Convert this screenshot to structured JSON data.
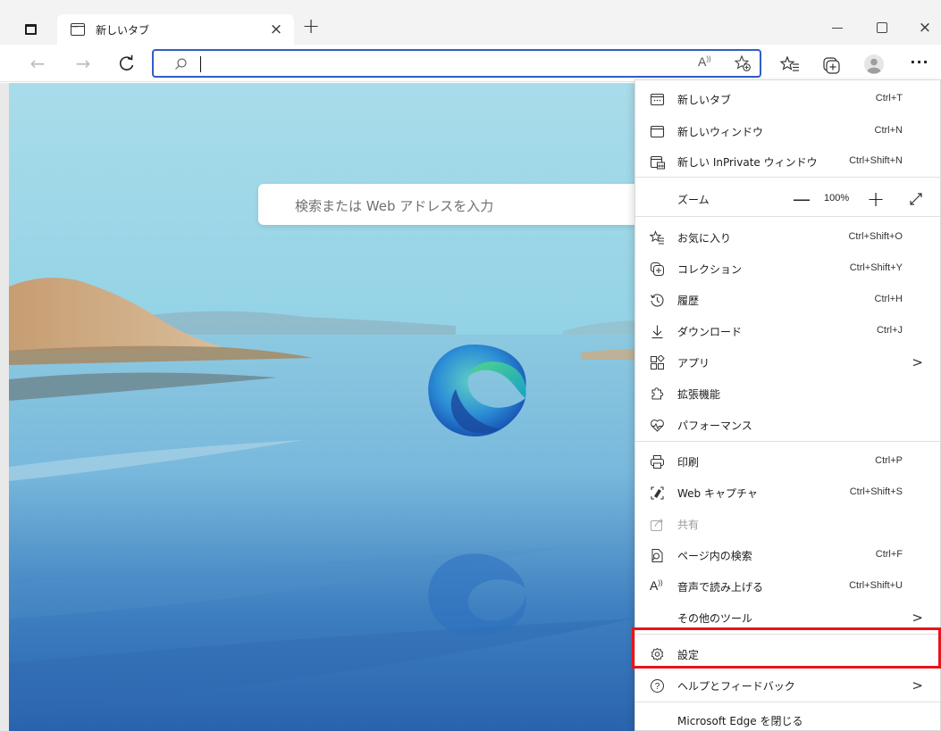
{
  "browser": {
    "tab": {
      "title": "新しいタブ",
      "close": "×"
    },
    "new_tab": "+",
    "window_controls": {
      "minimize": "",
      "maximize": "",
      "close": "×"
    }
  },
  "toolbar": {
    "back": "←",
    "forward": "→",
    "refresh": "C",
    "address": {
      "value": "",
      "placeholder": ""
    },
    "read_aloud": "A",
    "more": "···"
  },
  "page": {
    "search_placeholder": "検索または Web アドレスを入力"
  },
  "menu": {
    "items": [
      {
        "label": "新しいタブ",
        "shortcut": "Ctrl+T",
        "icon": "new-tab-icon"
      },
      {
        "label": "新しいウィンドウ",
        "shortcut": "Ctrl+N",
        "icon": "new-window-icon"
      },
      {
        "label": "新しい InPrivate ウィンドウ",
        "shortcut": "Ctrl+Shift+N",
        "icon": "inprivate-icon"
      },
      {
        "label": "ズーム",
        "zoom_minus": "—",
        "zoom_value": "100%",
        "zoom_plus": "+",
        "icon": ""
      },
      {
        "label": "お気に入り",
        "shortcut": "Ctrl+Shift+O",
        "icon": "favorites-icon"
      },
      {
        "label": "コレクション",
        "shortcut": "Ctrl+Shift+Y",
        "icon": "collections-icon"
      },
      {
        "label": "履歴",
        "shortcut": "Ctrl+H",
        "icon": "history-icon"
      },
      {
        "label": "ダウンロード",
        "shortcut": "Ctrl+J",
        "icon": "download-icon"
      },
      {
        "label": "アプリ",
        "chevron": ">",
        "icon": "apps-icon"
      },
      {
        "label": "拡張機能",
        "icon": "extensions-icon"
      },
      {
        "label": "パフォーマンス",
        "icon": "performance-icon"
      },
      {
        "label": "印刷",
        "shortcut": "Ctrl+P",
        "icon": "print-icon"
      },
      {
        "label": "Web キャプチャ",
        "shortcut": "Ctrl+Shift+S",
        "icon": "web-capture-icon"
      },
      {
        "label": "共有",
        "icon": "share-icon",
        "disabled": true
      },
      {
        "label": "ページ内の検索",
        "shortcut": "Ctrl+F",
        "icon": "find-icon"
      },
      {
        "label": "音声で読み上げる",
        "shortcut": "Ctrl+Shift+U",
        "icon": "read-aloud-icon",
        "icon_text": "A"
      },
      {
        "label": "その他のツール",
        "chevron": ">",
        "icon": ""
      },
      {
        "label": "設定",
        "icon": "settings-icon",
        "highlighted": true
      },
      {
        "label": "ヘルプとフィードバック",
        "chevron": ">",
        "icon": "help-icon",
        "icon_text": "?"
      },
      {
        "label": "Microsoft Edge を閉じる",
        "icon": ""
      }
    ]
  },
  "colors": {
    "highlight_border": "#e8141a",
    "omnibox_border": "#2f5ec4"
  }
}
